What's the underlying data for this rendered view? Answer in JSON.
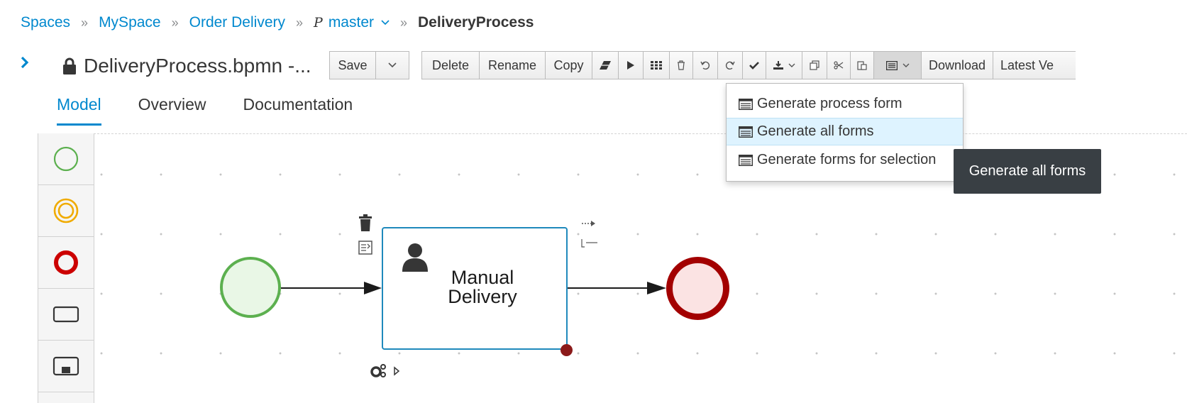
{
  "breadcrumb": {
    "items": [
      "Spaces",
      "MySpace",
      "Order Delivery"
    ],
    "separator": "»",
    "branch": "master",
    "current": "DeliveryProcess"
  },
  "asset": {
    "title": "DeliveryProcess.bpmn -..."
  },
  "toolbar": {
    "save": "Save",
    "delete": "Delete",
    "rename": "Rename",
    "copy": "Copy",
    "download": "Download",
    "latest_version": "Latest Ve"
  },
  "tabs": [
    "Model",
    "Overview",
    "Documentation"
  ],
  "active_tab": "Model",
  "palette": {
    "items": [
      "start-event",
      "intermediate-event",
      "end-event",
      "task",
      "subprocess"
    ]
  },
  "diagram": {
    "task_label": "Manual\nDelivery"
  },
  "generate_menu": {
    "items": [
      "Generate process form",
      "Generate all forms",
      "Generate forms for selection"
    ],
    "hovered": "Generate all forms"
  },
  "tooltip": "Generate all forms",
  "colors": {
    "link": "#0088ce",
    "start_event": "#5cb04f",
    "end_event": "#a30000",
    "task_border": "#1f89bc",
    "tooltip_bg": "#393f44"
  }
}
